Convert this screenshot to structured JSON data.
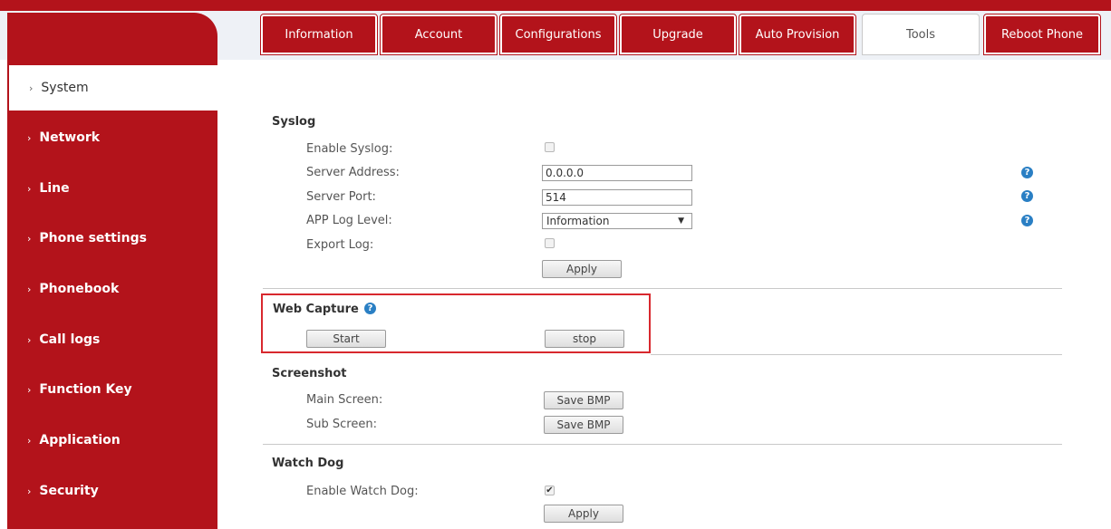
{
  "tabs": [
    {
      "label": "Information"
    },
    {
      "label": "Account"
    },
    {
      "label": "Configurations"
    },
    {
      "label": "Upgrade"
    },
    {
      "label": "Auto Provision"
    },
    {
      "label": "Tools",
      "active": true
    },
    {
      "label": "Reboot Phone"
    }
  ],
  "sidebar": {
    "items": [
      {
        "label": "System",
        "active": true
      },
      {
        "label": "Network"
      },
      {
        "label": "Line"
      },
      {
        "label": "Phone settings"
      },
      {
        "label": "Phonebook"
      },
      {
        "label": "Call logs"
      },
      {
        "label": "Function Key"
      },
      {
        "label": "Application"
      },
      {
        "label": "Security"
      }
    ],
    "chevron": "›"
  },
  "syslog": {
    "title": "Syslog",
    "enable_label": "Enable Syslog:",
    "enable_checked": false,
    "server_address_label": "Server Address:",
    "server_address_value": "0.0.0.0",
    "server_port_label": "Server Port:",
    "server_port_value": "514",
    "log_level_label": "APP Log Level:",
    "log_level_value": "Information",
    "export_label": "Export Log:",
    "export_checked": false,
    "apply_label": "Apply"
  },
  "web_capture": {
    "title": "Web Capture",
    "start_label": "Start",
    "stop_label": "stop"
  },
  "screenshot": {
    "title": "Screenshot",
    "main_label": "Main Screen:",
    "main_button": "Save BMP",
    "sub_label": "Sub Screen:",
    "sub_button": "Save BMP"
  },
  "watchdog": {
    "title": "Watch Dog",
    "enable_label": "Enable Watch Dog:",
    "enable_checked": true,
    "apply_label": "Apply"
  },
  "icons": {
    "help": "?",
    "dropdown": "▼",
    "check": "✔"
  },
  "colors": {
    "brand_red": "#b3131b",
    "highlight_red": "#d8282e",
    "help_blue": "#2a7fc4"
  }
}
